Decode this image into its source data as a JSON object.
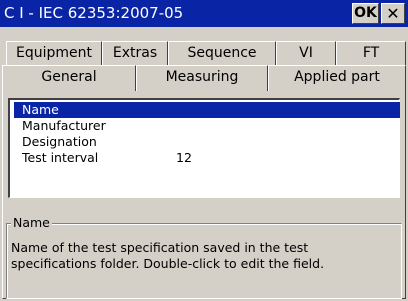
{
  "window": {
    "title": "C I - IEC 62353:2007-05",
    "ok_label": "OK",
    "close_label": "✕"
  },
  "tabs_row1": [
    {
      "label": "Equipment"
    },
    {
      "label": "Extras"
    },
    {
      "label": "Sequence"
    },
    {
      "label": "VI"
    },
    {
      "label": "FT"
    }
  ],
  "tabs_row2": [
    {
      "label": "General",
      "active": true
    },
    {
      "label": "Measuring"
    },
    {
      "label": "Applied part"
    }
  ],
  "fields": [
    {
      "label": "Name",
      "value": "",
      "selected": true
    },
    {
      "label": "Manufacturer",
      "value": ""
    },
    {
      "label": "Designation",
      "value": ""
    },
    {
      "label": "Test interval",
      "value": "12"
    }
  ],
  "description": {
    "title": "Name",
    "text": "Name of the test specification saved in the test specifications folder. Double-click to edit the field."
  },
  "colors": {
    "titlebar": "#0a24a6",
    "selection": "#0a24a6",
    "face": "#d4d0c8"
  }
}
